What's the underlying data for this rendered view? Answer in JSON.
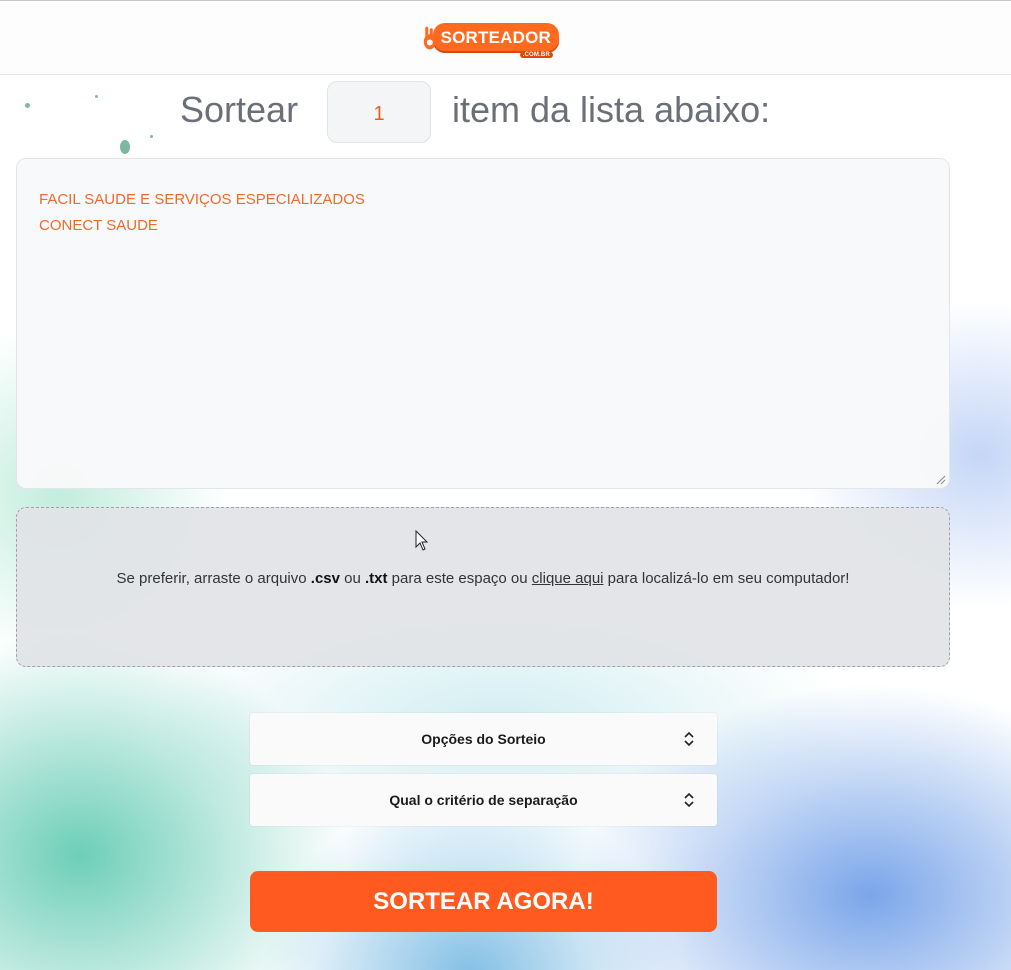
{
  "header": {
    "logo_text": "SORTEADOR",
    "logo_sub": ".COM.BR"
  },
  "title": {
    "prefix": "Sortear",
    "quantity": "1",
    "suffix": "item da lista abaixo:"
  },
  "list": {
    "items": [
      "FACIL SAUDE E SERVIÇOS ESPECIALIZADOS",
      "CONECT SAUDE"
    ]
  },
  "drop_zone": {
    "text_1": "Se preferir, arraste o arquivo ",
    "csv": ".csv",
    "text_2": " ou ",
    "txt": ".txt",
    "text_3": " para este espaço ou ",
    "link": "clique aqui",
    "text_4": " para localizá-lo em seu computador!"
  },
  "options": {
    "draw_options": "Opções do Sorteio",
    "separation_criteria": "Qual o critério de separação"
  },
  "cta": {
    "label": "SORTEAR AGORA!"
  },
  "colors": {
    "accent": "#ff5a1f",
    "list_text": "#ef6a2c",
    "title_text": "#6b6f77"
  }
}
